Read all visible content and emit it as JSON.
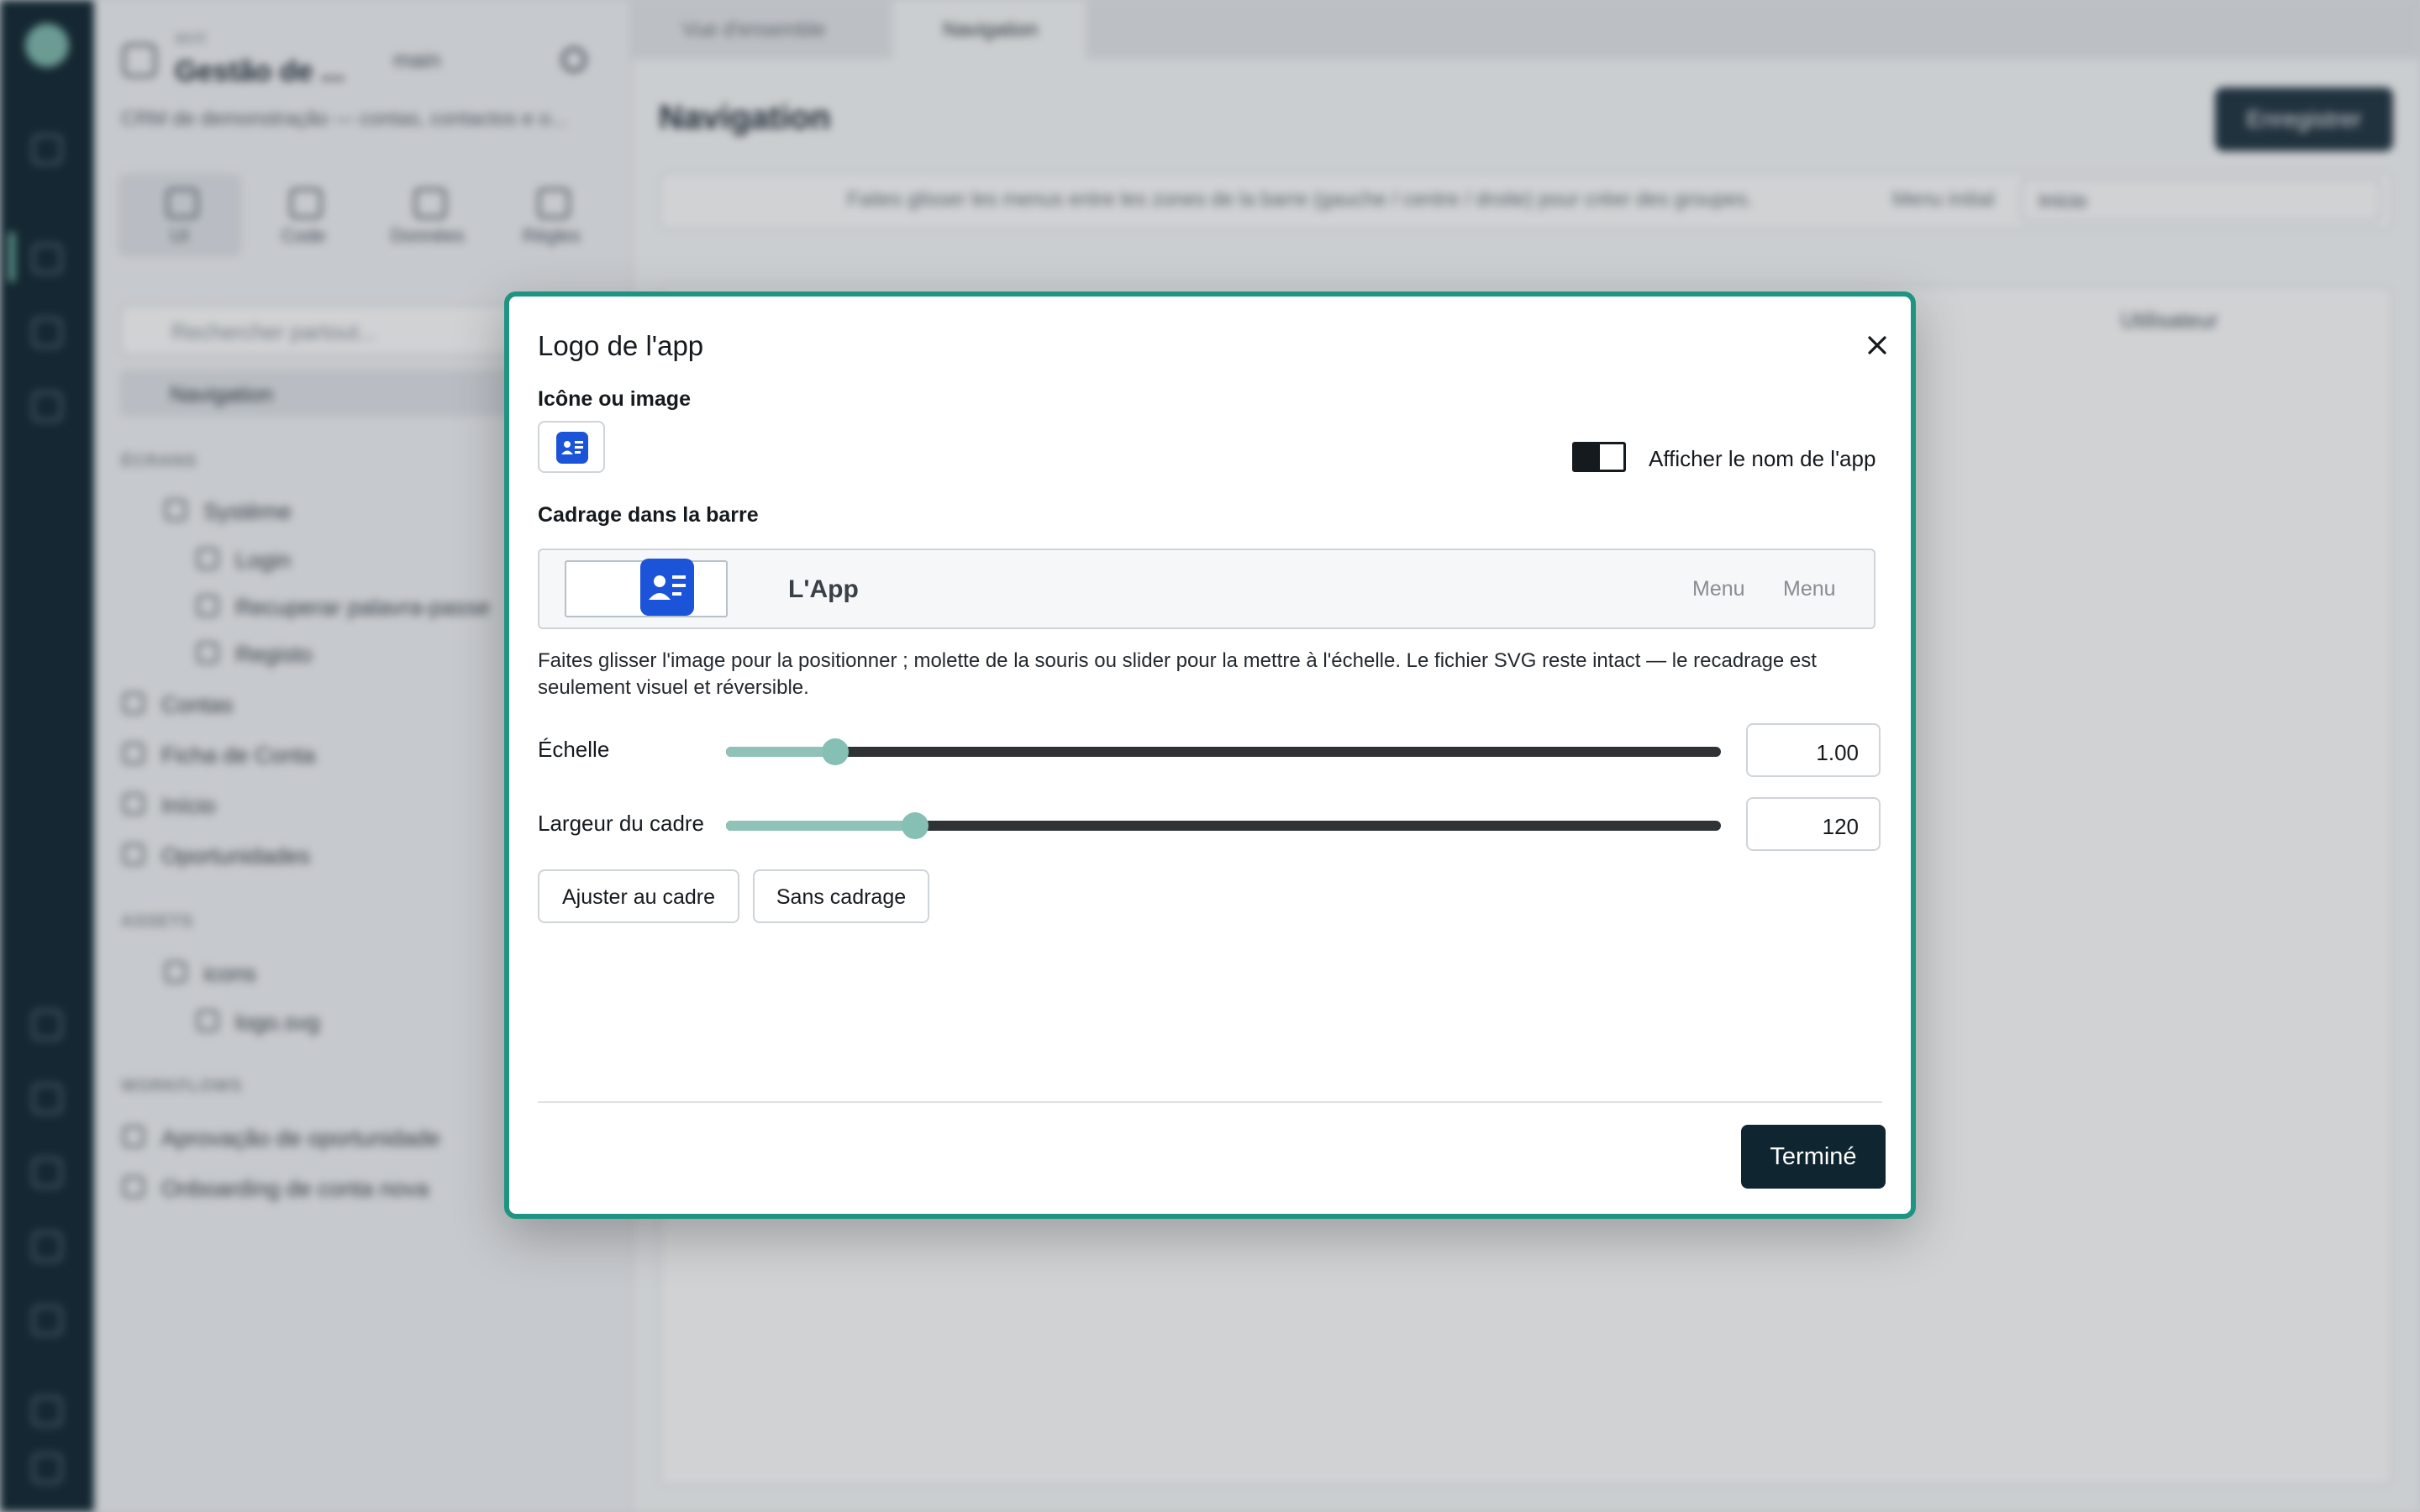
{
  "background": {
    "project": {
      "org": "acct",
      "name": "Gestão de ...",
      "branch": "main",
      "description": "CRM de demonstração — contas, contactos e o..."
    },
    "modes": [
      "UI",
      "Code",
      "Données",
      "Règles"
    ],
    "search_placeholder": "Rechercher partout...",
    "nav_selected": "Navigation",
    "sections": {
      "screens": "ÉCRANS",
      "assets": "ASSETS",
      "workflows": "WORKFLOWS"
    },
    "screens": [
      "Système",
      "Login",
      "Recuperar palavra-passe",
      "Registo",
      "Contas",
      "Ficha de Conta",
      "Início",
      "Oportunidades"
    ],
    "assets": [
      "icons",
      "logo.svg"
    ],
    "workflows": [
      "Aprovação de oportunidade",
      "Onboarding de conta nova"
    ],
    "tabs": [
      "Vue d'ensemble",
      "Navigation"
    ],
    "page_title": "Navigation",
    "save_label": "Enregistrer",
    "hint": "Faites glisser les menus entre les zones de la barre (gauche / centre / droite) pour créer des groupes.",
    "menu_label": "Menu initial",
    "menu_value": "Início",
    "user_menu": "Utilisateur"
  },
  "modal": {
    "title": "Logo de l'app",
    "icon_label": "Icône ou image",
    "toggle_label": "Afficher le nom de l'app",
    "toggle_on": true,
    "crop_label": "Cadrage dans la barre",
    "preview": {
      "app_name": "L'App",
      "menus": [
        "Menu",
        "Menu"
      ]
    },
    "description": "Faites glisser l'image pour la positionner ; molette de la souris ou slider pour la mettre à l'échelle. Le fichier SVG reste intact — le recadrage est seulement visuel et réversible.",
    "scale": {
      "label": "Échelle",
      "value": "1.00",
      "fraction": 0.11
    },
    "frame_width": {
      "label": "Largeur du cadre",
      "value": "120",
      "fraction": 0.19
    },
    "fit_button": "Ajuster au cadre",
    "no_crop_button": "Sans cadrage",
    "done_button": "Terminé"
  },
  "colors": {
    "accent": "#1f9483",
    "brand_blue": "#1b53d9",
    "dark": "#0f2530",
    "slider_fill": "#90c2b8"
  }
}
